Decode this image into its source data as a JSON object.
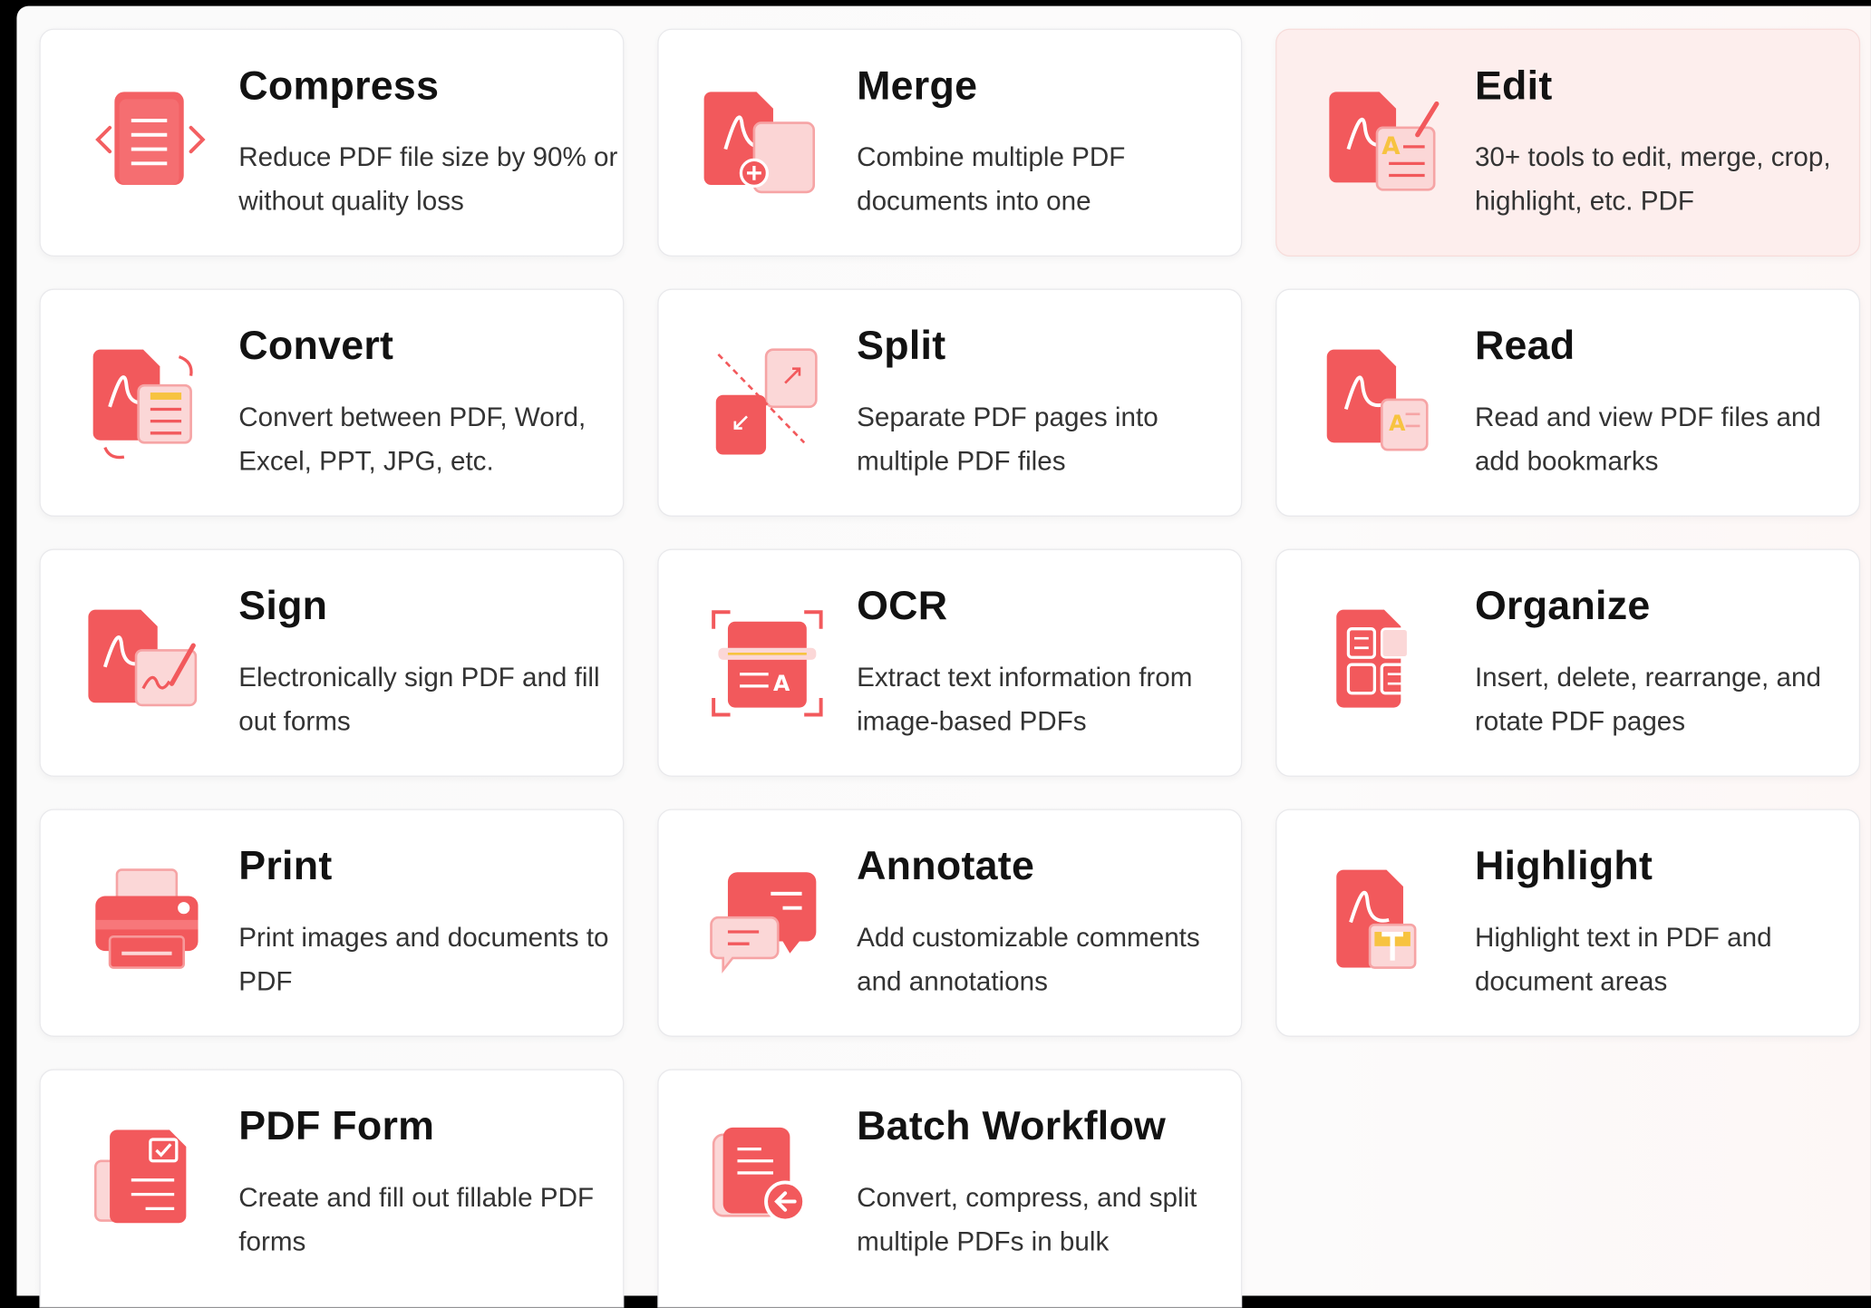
{
  "colors": {
    "accent": "#f2595c",
    "active_card_bg": "#fdeeed"
  },
  "tools": [
    {
      "title": "Compress",
      "desc": "Reduce PDF file size by 90% or without quality loss",
      "icon": "compress-icon"
    },
    {
      "title": "Merge",
      "desc": "Combine multiple PDF documents into one",
      "icon": "merge-icon"
    },
    {
      "title": "Edit",
      "desc": "30+ tools to edit, merge, crop, highlight, etc. PDF",
      "icon": "edit-icon",
      "selected": true
    },
    {
      "title": "Convert",
      "desc": "Convert between PDF, Word, Excel, PPT, JPG, etc.",
      "icon": "convert-icon"
    },
    {
      "title": "Split",
      "desc": "Separate PDF pages into multiple PDF files",
      "icon": "split-icon"
    },
    {
      "title": "Read",
      "desc": "Read and view PDF files and add bookmarks",
      "icon": "read-icon"
    },
    {
      "title": "Sign",
      "desc": "Electronically sign PDF and fill out forms",
      "icon": "sign-icon"
    },
    {
      "title": "OCR",
      "desc": "Extract text information from image-based PDFs",
      "icon": "ocr-icon"
    },
    {
      "title": "Organize",
      "desc": "Insert, delete, rearrange, and rotate PDF pages",
      "icon": "organize-icon"
    },
    {
      "title": "Print",
      "desc": "Print images and documents to PDF",
      "icon": "print-icon"
    },
    {
      "title": "Annotate",
      "desc": "Add customizable comments and annotations",
      "icon": "annotate-icon"
    },
    {
      "title": "Highlight",
      "desc": "Highlight text in PDF and document areas",
      "icon": "highlight-icon"
    },
    {
      "title": "PDF Form",
      "desc": "Create and fill out fillable PDF forms",
      "icon": "pdf-form-icon"
    },
    {
      "title": "Batch Workflow",
      "desc": "Convert, compress, and split multiple PDFs in bulk",
      "icon": "batch-workflow-icon"
    }
  ]
}
